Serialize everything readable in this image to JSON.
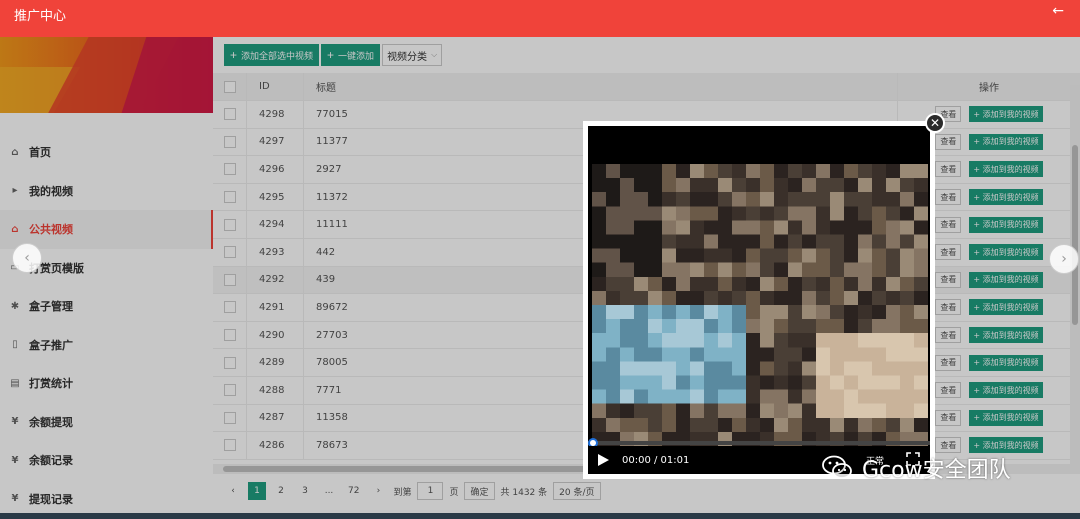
{
  "app": {
    "title": "推广中心",
    "back_icon": "arrow-left-icon"
  },
  "sidebar": {
    "items": [
      {
        "label": "首页",
        "icon": "home-icon",
        "glyph": "⌂"
      },
      {
        "label": "我的视频",
        "icon": "video-icon",
        "glyph": "▸"
      },
      {
        "label": "公共视频",
        "icon": "home-icon",
        "glyph": "⌂",
        "active": true
      },
      {
        "label": "打赏页模版",
        "icon": "template-icon",
        "glyph": "▭"
      },
      {
        "label": "盒子管理",
        "icon": "palm-icon",
        "glyph": "✱"
      },
      {
        "label": "盒子推广",
        "icon": "document-icon",
        "glyph": "▯"
      },
      {
        "label": "打赏统计",
        "icon": "file-icon",
        "glyph": "▤"
      },
      {
        "label": "余额提现",
        "icon": "yen-icon",
        "glyph": "¥"
      },
      {
        "label": "余额记录",
        "icon": "yen-icon",
        "glyph": "¥"
      },
      {
        "label": "提现记录",
        "icon": "yen-icon",
        "glyph": "¥"
      }
    ]
  },
  "toolbar": {
    "add_selected_label": "添加全部选中视频",
    "one_click_label": "一键添加",
    "category_select": "视频分类"
  },
  "table": {
    "headers": {
      "id": "ID",
      "title": "标题",
      "actions": "操作"
    },
    "view_label": "查看",
    "add_label": "添加到我的视频",
    "rows": [
      {
        "id": "4298",
        "title": "77015"
      },
      {
        "id": "4297",
        "title": "11377"
      },
      {
        "id": "4296",
        "title": "2927"
      },
      {
        "id": "4295",
        "title": "11372"
      },
      {
        "id": "4294",
        "title": "11111"
      },
      {
        "id": "4293",
        "title": "442"
      },
      {
        "id": "4292",
        "title": "439"
      },
      {
        "id": "4291",
        "title": "89672"
      },
      {
        "id": "4290",
        "title": "27703"
      },
      {
        "id": "4289",
        "title": "78005"
      },
      {
        "id": "4288",
        "title": "7771"
      },
      {
        "id": "4287",
        "title": "11358"
      },
      {
        "id": "4286",
        "title": "78673"
      }
    ]
  },
  "pagination": {
    "pages": [
      "1",
      "2",
      "3",
      "...",
      "72"
    ],
    "current": "1",
    "goto_prefix": "到第",
    "goto_value": "1",
    "goto_suffix": "页",
    "confirm_label": "确定",
    "total_text": "共 1432 条",
    "page_size": "20 条/页"
  },
  "player": {
    "time": "00:00 / 01:01",
    "quality": "正常",
    "progress": 0
  },
  "watermark": {
    "text": "Gcow安全团队"
  },
  "colors": {
    "brand": "#f0433a",
    "accent": "#1f9e80"
  }
}
